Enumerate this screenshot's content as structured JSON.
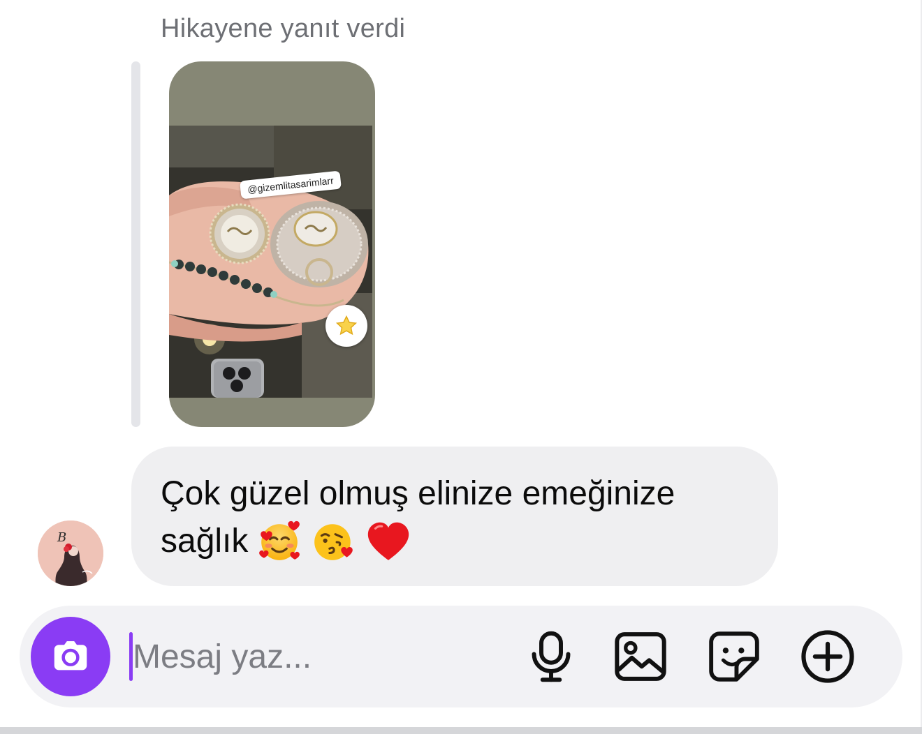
{
  "thread": {
    "reply_label": "Hikayene yanıt verdi",
    "story": {
      "mention_sticker": "@gizemlitasarimlarr",
      "badge_icon": "star-icon"
    },
    "message": {
      "line1": "Çok güzel olmuş elinize emeğinize",
      "line2": "sağlık",
      "emojis": [
        "smiling-face-with-hearts",
        "face-blowing-a-kiss",
        "red-heart"
      ]
    },
    "sender_avatar": "avatar"
  },
  "composer": {
    "placeholder": "Mesaj yaz...",
    "value": "",
    "accent_color": "#8a3cf4",
    "icons": [
      "camera-icon",
      "microphone-icon",
      "gallery-icon",
      "sticker-icon",
      "plus-icon"
    ]
  }
}
